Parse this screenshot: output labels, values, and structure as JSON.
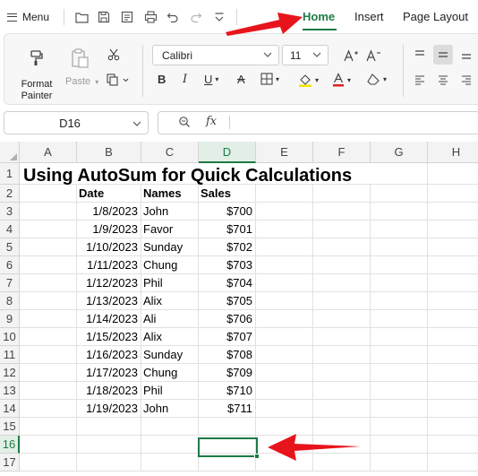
{
  "topbar": {
    "menu_label": "Menu",
    "quick_access_icons": [
      "folder-open-icon",
      "save-icon",
      "export-icon",
      "print-icon",
      "undo-icon",
      "redo-icon",
      "more-icon"
    ],
    "tabs": [
      {
        "label": "Home",
        "active": true
      },
      {
        "label": "Insert",
        "active": false
      },
      {
        "label": "Page Layout",
        "active": false
      }
    ],
    "accent_color": "#1d7a45"
  },
  "ribbon": {
    "format_painter_label_1": "Format",
    "format_painter_label_2": "Painter",
    "paste_label": "Paste",
    "font_name": "Calibri",
    "font_size": "11",
    "font_color_accent": "#e02020",
    "fill_color_accent": "#f5e200"
  },
  "formula_bar": {
    "cell_reference": "D16",
    "fx_label": "fx",
    "formula_value": ""
  },
  "sheet": {
    "columns": [
      "A",
      "B",
      "C",
      "D",
      "E",
      "F",
      "G",
      "H"
    ],
    "rows": [
      "1",
      "2",
      "3",
      "4",
      "5",
      "6",
      "7",
      "8",
      "9",
      "10",
      "11",
      "12",
      "13",
      "14",
      "15",
      "16",
      "17"
    ],
    "selected_column": "D",
    "selected_row": "16",
    "title": "Using AutoSum for Quick Calculations",
    "headers": {
      "date": "Date",
      "names": "Names",
      "sales": "Sales"
    },
    "records": [
      {
        "date": "1/8/2023",
        "name": "John",
        "sales": "$700"
      },
      {
        "date": "1/9/2023",
        "name": "Favor",
        "sales": "$701"
      },
      {
        "date": "1/10/2023",
        "name": "Sunday",
        "sales": "$702"
      },
      {
        "date": "1/11/2023",
        "name": "Chung",
        "sales": "$703"
      },
      {
        "date": "1/12/2023",
        "name": "Phil",
        "sales": "$704"
      },
      {
        "date": "1/13/2023",
        "name": "Alix",
        "sales": "$705"
      },
      {
        "date": "1/14/2023",
        "name": "Ali",
        "sales": "$706"
      },
      {
        "date": "1/15/2023",
        "name": "Alix",
        "sales": "$707"
      },
      {
        "date": "1/16/2023",
        "name": "Sunday",
        "sales": "$708"
      },
      {
        "date": "1/17/2023",
        "name": "Chung",
        "sales": "$709"
      },
      {
        "date": "1/18/2023",
        "name": "Phil",
        "sales": "$710"
      },
      {
        "date": "1/19/2023",
        "name": "John",
        "sales": "$711"
      }
    ]
  },
  "annotations": {
    "arrow_color": "#e8141c"
  }
}
